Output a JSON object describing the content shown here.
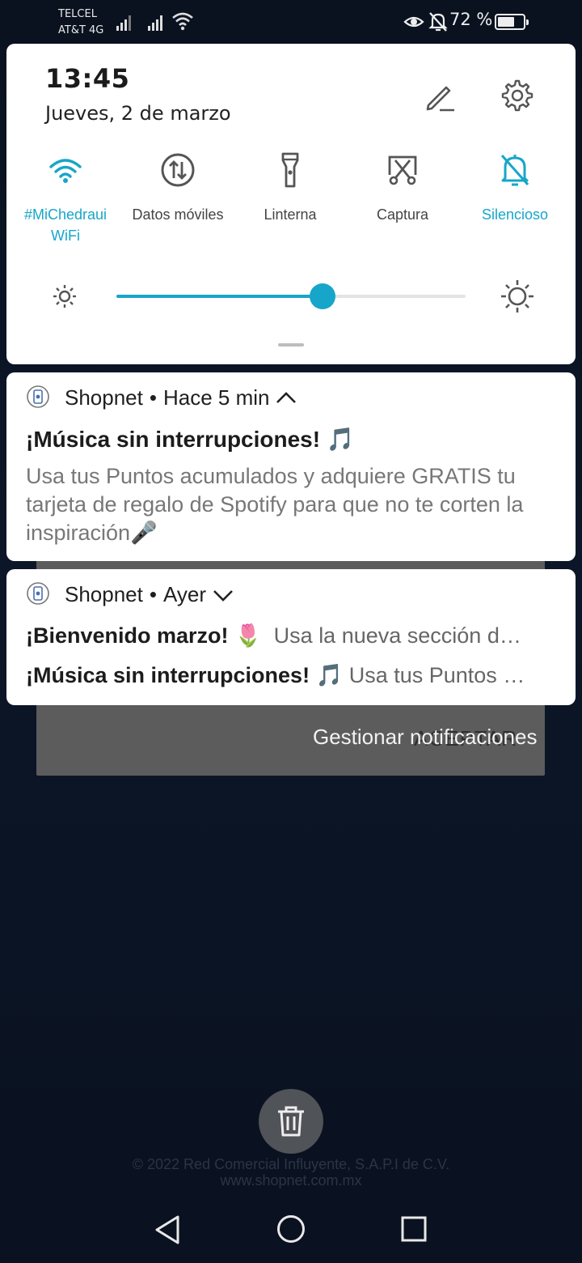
{
  "status_bar": {
    "carrier_1": "TELCEL",
    "carrier_2": "AT&T 4G",
    "battery_percent": "72 %",
    "battery_level": 0.72
  },
  "quick_settings": {
    "time": "13:45",
    "date": "Jueves, 2 de marzo",
    "tiles": [
      {
        "label_1": "#MiChedraui",
        "label_2": "WiFi",
        "active": true,
        "icon": "wifi-icon"
      },
      {
        "label_1": "Datos móviles",
        "label_2": "",
        "active": false,
        "icon": "mobile-data-icon"
      },
      {
        "label_1": "Linterna",
        "label_2": "",
        "active": false,
        "icon": "flashlight-icon"
      },
      {
        "label_1": "Captura",
        "label_2": "",
        "active": false,
        "icon": "screenshot-icon"
      },
      {
        "label_1": "Silencioso",
        "label_2": "",
        "active": true,
        "icon": "bell-off-icon"
      }
    ],
    "brightness": 0.59,
    "accent_color": "#17a6c9"
  },
  "notifications": [
    {
      "app": "Shopnet",
      "time": "Hace 5 min",
      "expanded": true,
      "title": "¡Música sin interrupciones! 🎵",
      "body": "Usa tus Puntos acumulados y adquiere GRATIS tu tarjeta de regalo de Spotify para que no te corten la inspiración🎤"
    },
    {
      "app": "Shopnet",
      "time": "Ayer",
      "expanded": false,
      "lines": [
        {
          "title": "¡Bienvenido marzo! 🌷",
          "text": "Usa la nueva sección d…"
        },
        {
          "title": "¡Música sin interrupciones! 🎵",
          "text": "Usa tus Puntos …"
        }
      ]
    }
  ],
  "manage_notifications": "Gestionar notificaciones",
  "background": {
    "dialog_button": "ACEPTAR",
    "copyright_1": "© 2022 Red Comercial Influyente, S.A.P.I de C.V.",
    "copyright_2": "www.shopnet.com.mx"
  }
}
